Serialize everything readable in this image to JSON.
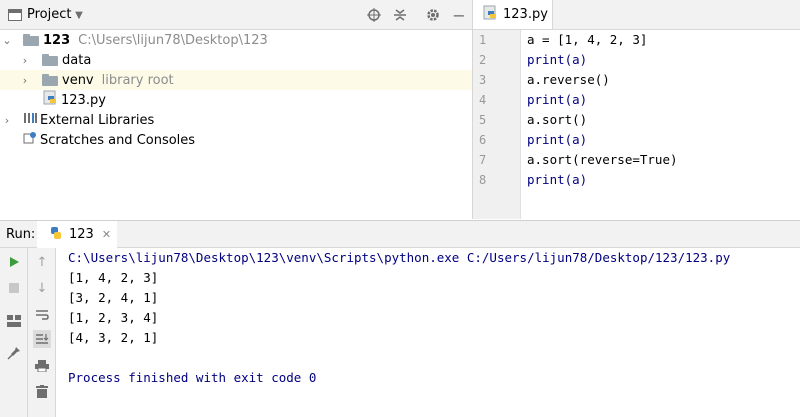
{
  "project": {
    "title": "Project",
    "tree": [
      {
        "name": "123",
        "detail": "C:\\Users\\lijun78\\Desktop\\123"
      },
      {
        "name": "data"
      },
      {
        "name": "venv",
        "detail": "library root"
      },
      {
        "name": "123.py"
      },
      {
        "name": "External Libraries"
      },
      {
        "name": "Scratches and Consoles"
      }
    ]
  },
  "editor": {
    "tab": "123.py",
    "line_numbers": [
      "1",
      "2",
      "3",
      "4",
      "5",
      "6",
      "7",
      "8"
    ],
    "code": [
      "a = [1, 4, 2, 3]",
      "print(a)",
      "a.reverse()",
      "print(a)",
      "a.sort()",
      "print(a)",
      "a.sort(reverse=True)",
      "print(a)"
    ]
  },
  "run": {
    "label": "Run:",
    "tab": "123",
    "output": [
      "C:\\Users\\lijun78\\Desktop\\123\\venv\\Scripts\\python.exe C:/Users/lijun78/Desktop/123/123.py",
      "[1, 4, 2, 3]",
      "[3, 2, 4, 1]",
      "[1, 2, 3, 4]",
      "[4, 3, 2, 1]",
      "",
      "Process finished with exit code 0"
    ]
  },
  "colors": {
    "keyword": "#000080",
    "number": "#0000ff",
    "run_green": "#3c9b3c"
  }
}
